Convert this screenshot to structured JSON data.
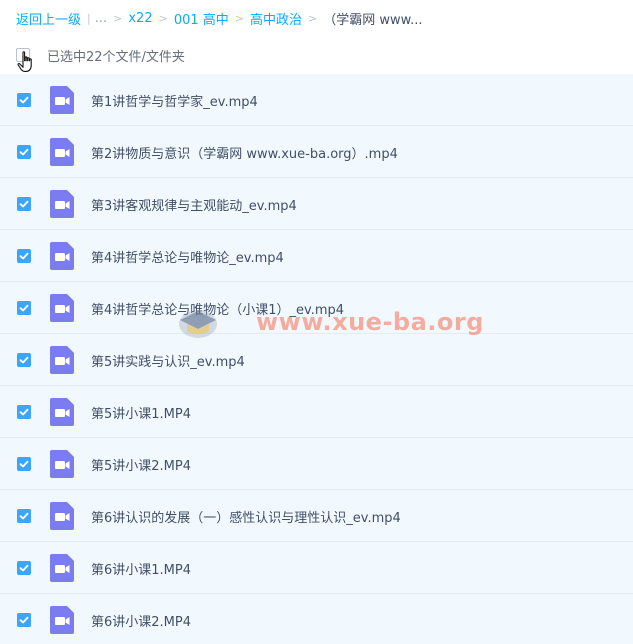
{
  "breadcrumb": {
    "back": "返回上一级",
    "ellipsis": "...",
    "items": [
      "x22",
      "001 高中",
      "高中政治"
    ],
    "current": "（学霸网 www..."
  },
  "selection": {
    "text": "已选中22个文件/文件夹"
  },
  "files": [
    {
      "name": "第1讲哲学与哲学家_ev.mp4"
    },
    {
      "name": "第2讲物质与意识（学霸网 www.xue-ba.org）.mp4"
    },
    {
      "name": "第3讲客观规律与主观能动_ev.mp4"
    },
    {
      "name": "第4讲哲学总论与唯物论_ev.mp4"
    },
    {
      "name": "第4讲哲学总论与唯物论（小课1）_ev.mp4"
    },
    {
      "name": "第5讲实践与认识_ev.mp4"
    },
    {
      "name": "第5讲小课1.MP4"
    },
    {
      "name": "第5讲小课2.MP4"
    },
    {
      "name": "第6讲认识的发展（一）感性认识与理性认识_ev.mp4"
    },
    {
      "name": "第6讲小课1.MP4"
    },
    {
      "name": "第6讲小课2.MP4"
    }
  ],
  "watermark": {
    "text": "www.xue-ba.org"
  },
  "colors": {
    "accent": "#09aaff",
    "checkbox": "#3ba5f7",
    "video_icon": "#7b7cf0",
    "row_bg": "#f2f9fe"
  },
  "icons": {
    "file": "video-file-icon",
    "check": "check-icon",
    "cursor": "hand-pointer-icon"
  }
}
